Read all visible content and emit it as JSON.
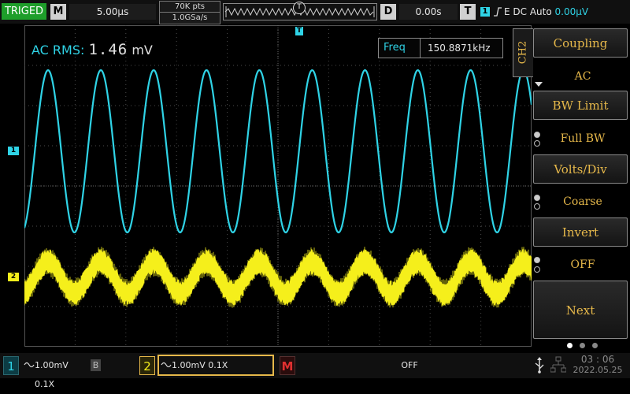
{
  "top": {
    "trig_status": "TRIGED",
    "horizontal_mode": "M",
    "timebase": "5.00μs",
    "memory_depth": "70K pts",
    "sample_rate": "1.0GSa/s",
    "trigger_marker": "T",
    "delay_mode": "D",
    "delay_value": "0.00s",
    "trigger_label": "T",
    "trigger_source": "1",
    "trigger_edge_icon": "rising-edge-icon",
    "trigger_info": "E DC Auto",
    "trigger_level": "0.00μV"
  },
  "measure": {
    "label": "AC RMS:",
    "value": "1.46",
    "unit": "mV",
    "freq_label": "Freq",
    "freq_value": "150.8871kHz"
  },
  "plot": {
    "trigger_marker": "T",
    "ch1_marker": "1",
    "ch2_marker": "2",
    "ch1_color": "#2fd3e6",
    "ch2_color": "#f5ef1b",
    "ch1_cycles": 9.6,
    "ch2_cycles": 9.6
  },
  "menu": {
    "channel_tab": "CH2",
    "coupling_label": "Coupling",
    "coupling_value": "AC",
    "bw_label": "BW Limit",
    "bw_value": "Full BW",
    "volts_label": "Volts/Div",
    "volts_value": "Coarse",
    "invert_label": "Invert",
    "invert_value": "OFF",
    "next_label": "Next",
    "page_dots": 3
  },
  "bottom": {
    "ch1_num": "1",
    "ch1_info": "1.00mV 0.1X",
    "ch1_bw": "B",
    "ch2_num": "2",
    "ch2_info": "1.00mV 0.1X",
    "math_label": "M",
    "math_state": "OFF",
    "time": "03 : 06",
    "date": "2022.05.25"
  }
}
